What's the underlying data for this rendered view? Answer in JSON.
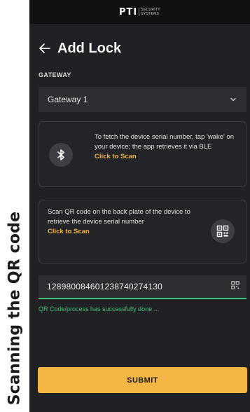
{
  "caption": "Scanning the QR code",
  "brand": {
    "main": "PTI",
    "sub_line1": "SECURITY",
    "sub_line2": "SYSTEMS"
  },
  "header": {
    "back_icon": "arrow-left-icon",
    "title": "Add Lock"
  },
  "gateway": {
    "label": "GATEWAY",
    "selected": "Gateway 1",
    "icon": "chevron-down-icon"
  },
  "ble_card": {
    "icon": "bluetooth-icon",
    "text": "To fetch the device serial number, tap 'wake' on your device; the app retrieves it via BLE",
    "link": "Click to Scan"
  },
  "qr_card": {
    "icon": "qr-code-icon",
    "text": "Scan QR code on the back plate of the device to retrieve the device serial number",
    "link": "Click to Scan"
  },
  "serial_field": {
    "value": "128980084601238740274130",
    "icon": "qr-code-icon"
  },
  "status": {
    "message": "QR Code/process has successfully done ..."
  },
  "submit": {
    "label": "SUBMIT"
  },
  "colors": {
    "background": "#202124",
    "card": "#232427",
    "accent": "#f4b544",
    "link": "#f2b33d",
    "success": "#3fc27a"
  }
}
